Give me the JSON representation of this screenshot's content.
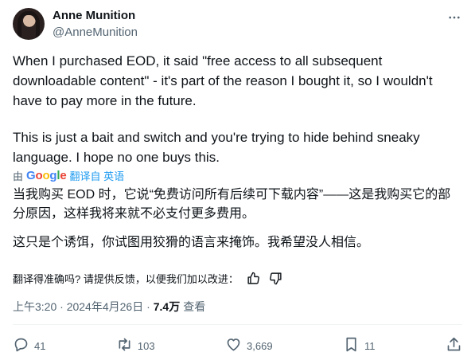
{
  "author": {
    "name": "Anne Munition",
    "handle": "@AnneMunition"
  },
  "tweet": {
    "paragraph1": "When I purchased EOD, it said \"free access to all subsequent downloadable content\" - it's part of the reason I bought it, so I wouldn't have to pay more in the future.",
    "paragraph2": "This is just a bait and switch and you're trying to hide behind sneaky language. I hope no one buys this."
  },
  "translation": {
    "by_prefix": "由",
    "provider_letters": [
      "G",
      "o",
      "o",
      "g",
      "l",
      "e"
    ],
    "translated_from": "翻译自 英语",
    "zh_paragraph1": "当我购买 EOD 时，它说“免费访问所有后续可下载内容”——这是我购买它的部分原因，这样我将来就不必支付更多费用。",
    "zh_paragraph2": "这只是个诱饵，你试图用狡猾的语言来掩饰。我希望没人相信。",
    "feedback_prompt": "翻译得准确吗? 请提供反馈，以便我们加以改进："
  },
  "meta": {
    "time_date": "上午3:20 · 2024年4月26日 · ",
    "views_count": "7.4万",
    "views_label": "查看"
  },
  "actions": {
    "replies": "41",
    "reposts": "103",
    "likes": "3,669",
    "bookmarks": "11"
  },
  "icons": {
    "more": "more-options-icon",
    "thumbs_up": "thumbs-up-icon",
    "thumbs_down": "thumbs-down-icon",
    "reply": "reply-icon",
    "repost": "repost-icon",
    "like": "heart-icon",
    "bookmark": "bookmark-icon",
    "share": "share-icon"
  },
  "colors": {
    "text": "#0f1419",
    "secondary": "#536471",
    "link": "#1d9bf0",
    "divider": "#eff3f4"
  }
}
